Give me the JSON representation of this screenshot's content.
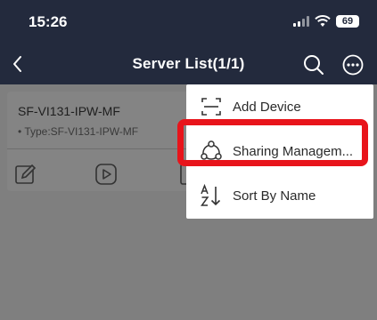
{
  "status_bar": {
    "time": "15:26",
    "battery": "69"
  },
  "nav": {
    "title": "Server List(1/1)"
  },
  "device": {
    "name": "SF-VI131-IPW-MF",
    "type": "• Type:SF-VI131-IPW-MF"
  },
  "menu": {
    "items": [
      {
        "label": "Add Device",
        "icon": "add-device-icon"
      },
      {
        "label": "Sharing Managem...",
        "icon": "share-icon"
      },
      {
        "label": "Sort By Name",
        "icon": "sort-az-icon"
      }
    ]
  },
  "colors": {
    "header_bg": "#232a3d",
    "highlight": "#e8141b",
    "overlay": "#7f7f7f"
  }
}
